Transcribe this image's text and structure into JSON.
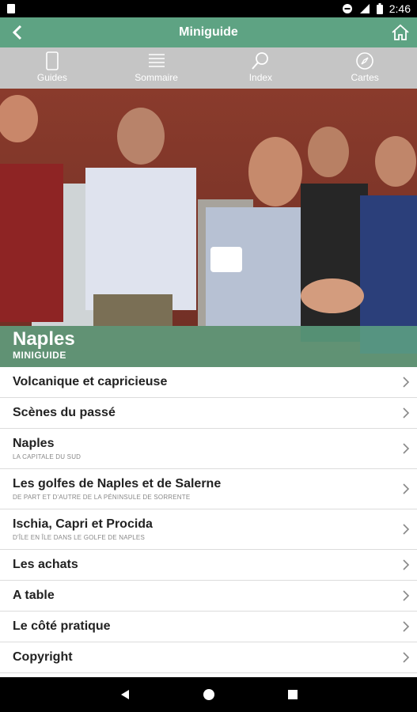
{
  "status": {
    "time": "2:46"
  },
  "header": {
    "title": "Miniguide"
  },
  "toolbar": {
    "tabs": [
      {
        "label": "Guides",
        "icon": "phone-icon"
      },
      {
        "label": "Sommaire",
        "icon": "list-icon"
      },
      {
        "label": "Index",
        "icon": "magnifier-icon"
      },
      {
        "label": "Cartes",
        "icon": "compass-icon"
      }
    ]
  },
  "hero": {
    "city": "Naples",
    "subtitle": "MINIGUIDE"
  },
  "list": {
    "items": [
      {
        "label": "Volcanique et capricieuse",
        "caption": ""
      },
      {
        "label": "Scènes du passé",
        "caption": ""
      },
      {
        "label": "Naples",
        "caption": "LA CAPITALE DU SUD"
      },
      {
        "label": "Les golfes de Naples et de Salerne",
        "caption": "DE PART ET D'AUTRE DE LA PÉNINSULE DE SORRENTE"
      },
      {
        "label": "Ischia, Capri et Procida",
        "caption": "D'ÎLE EN ÎLE DANS LE GOLFE DE NAPLES"
      },
      {
        "label": "Les achats",
        "caption": ""
      },
      {
        "label": "A table",
        "caption": ""
      },
      {
        "label": "Le côté pratique",
        "caption": ""
      },
      {
        "label": "Copyright",
        "caption": ""
      }
    ]
  },
  "colors": {
    "accent": "#5ea383",
    "toolbar": "#c5c5c5"
  }
}
